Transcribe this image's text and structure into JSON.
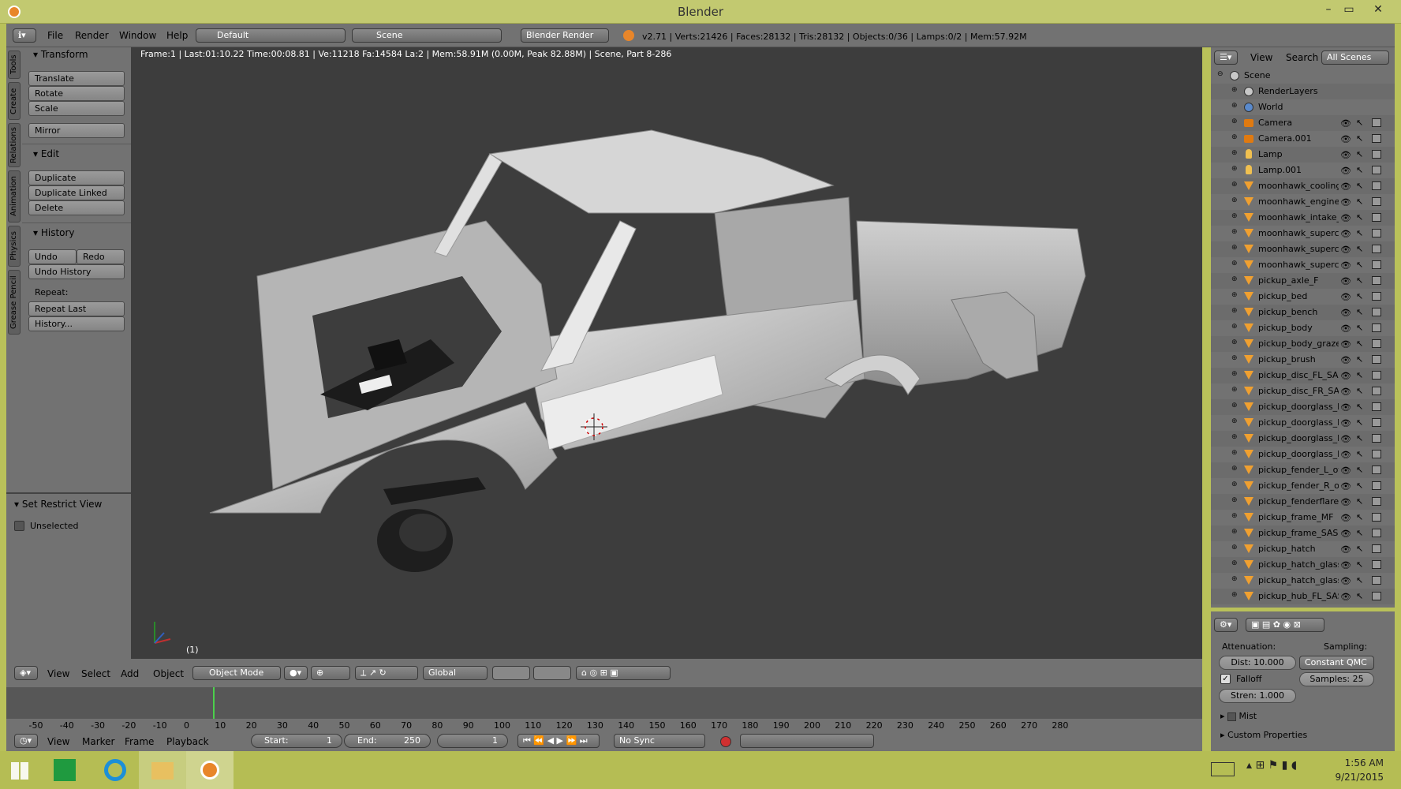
{
  "window": {
    "title": "Blender"
  },
  "info_header": {
    "menus": [
      "File",
      "Render",
      "Window",
      "Help"
    ],
    "layout": "Default",
    "scene": "Scene",
    "engine": "Blender Render",
    "stats": "v2.71 | Verts:21426 | Faces:28132 | Tris:28132 | Objects:0/36 | Lamps:0/2 | Mem:57.92M"
  },
  "tool_shelf": {
    "tabs": [
      "Tools",
      "Create",
      "Relations",
      "Animation",
      "Physics",
      "Grease Pencil"
    ],
    "transform": {
      "title": "Transform",
      "buttons": [
        "Translate",
        "Rotate",
        "Scale",
        "Mirror"
      ]
    },
    "edit": {
      "title": "Edit",
      "buttons": [
        "Duplicate",
        "Duplicate Linked",
        "Delete"
      ]
    },
    "history": {
      "title": "History",
      "undo": "Undo",
      "redo": "Redo",
      "undo_history": "Undo History",
      "repeat_label": "Repeat:",
      "repeat_last": "Repeat Last",
      "history_btn": "History..."
    },
    "restrict": {
      "title": "Set Restrict View",
      "unselected": "Unselected"
    }
  },
  "viewport": {
    "render_info": "Frame:1 | Last:01:10.22 Time:00:08.81 | Ve:11218 Fa:14584 La:2 | Mem:58.91M (0.00M, Peak 82.88M) | Scene, Part 8-286",
    "frame_label": "(1)"
  },
  "viewport_header": {
    "menus": [
      "View",
      "Select",
      "Add",
      "Object"
    ],
    "mode": "Object Mode",
    "orientation": "Global"
  },
  "timeline": {
    "ticks": [
      "-50",
      "-40",
      "-30",
      "-20",
      "-10",
      "0",
      "10",
      "20",
      "30",
      "40",
      "50",
      "60",
      "70",
      "80",
      "90",
      "100",
      "110",
      "120",
      "130",
      "140",
      "150",
      "160",
      "170",
      "180",
      "190",
      "200",
      "210",
      "220",
      "230",
      "240",
      "250",
      "260",
      "270",
      "280"
    ],
    "menus": [
      "View",
      "Marker",
      "Frame",
      "Playback"
    ],
    "start_label": "Start:",
    "start": "1",
    "end_label": "End:",
    "end": "250",
    "current": "1",
    "sync": "No Sync"
  },
  "outliner": {
    "menus": [
      "View",
      "Search"
    ],
    "display": "All Scenes",
    "items": [
      "Scene",
      "RenderLayers",
      "World",
      "Camera",
      "Camera.001",
      "Lamp",
      "Lamp.001",
      "moonhawk_cooling",
      "moonhawk_engine_",
      "moonhawk_intake_",
      "moonhawk_supercl",
      "moonhawk_supercl",
      "moonhawk_supercl",
      "pickup_axle_F",
      "pickup_bed",
      "pickup_bench",
      "pickup_body",
      "pickup_body_grazer",
      "pickup_brush",
      "pickup_disc_FL_SAS",
      "pickup_disc_FR_SAS",
      "pickup_doorglass_L",
      "pickup_doorglass_L",
      "pickup_doorglass_R",
      "pickup_doorglass_R",
      "pickup_fender_L_of",
      "pickup_fender_R_of",
      "pickup_fenderflare_",
      "pickup_frame_MF",
      "pickup_frame_SAS",
      "pickup_hatch",
      "pickup_hatch_glass",
      "pickup_hatch_glass",
      "pickup_hub_FL_SAS"
    ]
  },
  "properties": {
    "attenuation": "Attenuation:",
    "sampling": "Sampling:",
    "dist": "Dist: 10.000",
    "sampling_mode": "Constant QMC",
    "falloff": "Falloff",
    "samples": "Samples: 25",
    "strength": "Stren: 1.000",
    "mist": "Mist",
    "custom": "Custom Properties"
  },
  "taskbar": {
    "time": "1:56 AM",
    "date": "9/21/2015"
  }
}
